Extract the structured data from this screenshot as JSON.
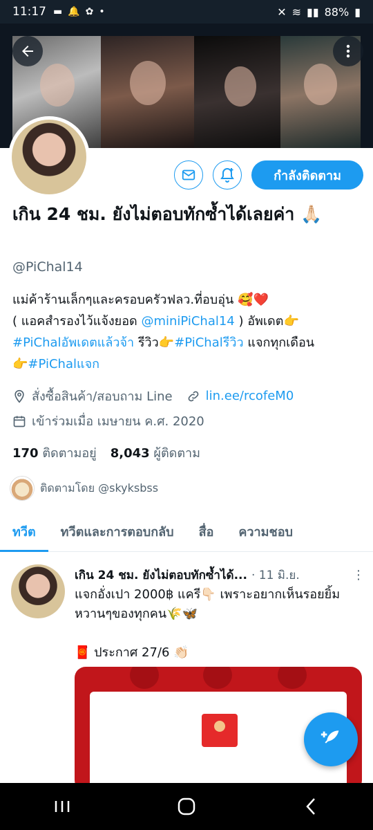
{
  "status_bar": {
    "time": "11:17",
    "battery": "88%"
  },
  "profile": {
    "name": "เกิน 24 ชม. ยังไม่ตอบทักซ้ำได้เลยค่า 🙏🏻",
    "handle": "@PiChal14",
    "follow_button_label": "กำลังติดตาม",
    "bio": {
      "line1": "แม่ค้าร้านเล็กๆและครอบครัวฟลว.ที่อบอุ่น 🥰❤️",
      "line2_prefix": "( แอคสำรองไว้แจ้งยอด ",
      "line2_link": "@miniPiChal14",
      "line2_suffix": " ) อัพเดต👉",
      "line3_link1": "#PiChalอัพเดตแล้วจ้า",
      "line3_mid": " รีวิว👉",
      "line3_link2": "#PiChalรีวิว",
      "line3_suffix": " แจกทุกเดือน",
      "line4_prefix": "👉",
      "line4_link": "#PiChalแจก"
    },
    "location": "สั่งซื้อสินค้า/สอบถาม Line",
    "website": "lin.ee/rcofeM0",
    "joined": "เข้าร่วมเมื่อ เมษายน ค.ศ. 2020",
    "following_count": "170",
    "following_label": "ติดตามอยู่",
    "followers_count": "8,043",
    "followers_label": "ผู้ติดตาม",
    "followed_by": "ติดตามโดย @skyksbss"
  },
  "tabs": [
    {
      "label": "ทวีต",
      "active": true
    },
    {
      "label": "ทวีตและการตอบกลับ",
      "active": false
    },
    {
      "label": "สื่อ",
      "active": false
    },
    {
      "label": "ความชอบ",
      "active": false
    }
  ],
  "tweet": {
    "author": "เกิน 24 ชม. ยังไม่ตอบทักซ้ำได้...",
    "date": "· 11 มิ.ย.",
    "text": "แจกอั่งเปา 2000฿ แครี👇🏻 เพราะอยากเห็นรอยยิ้มหวานๆของทุกคน🌾🦋",
    "announcement": "🧧 ประกาศ 27/6 👏🏻"
  },
  "colors": {
    "accent": "#1d9bf0",
    "text": "#0f1419",
    "secondary": "#536471"
  }
}
